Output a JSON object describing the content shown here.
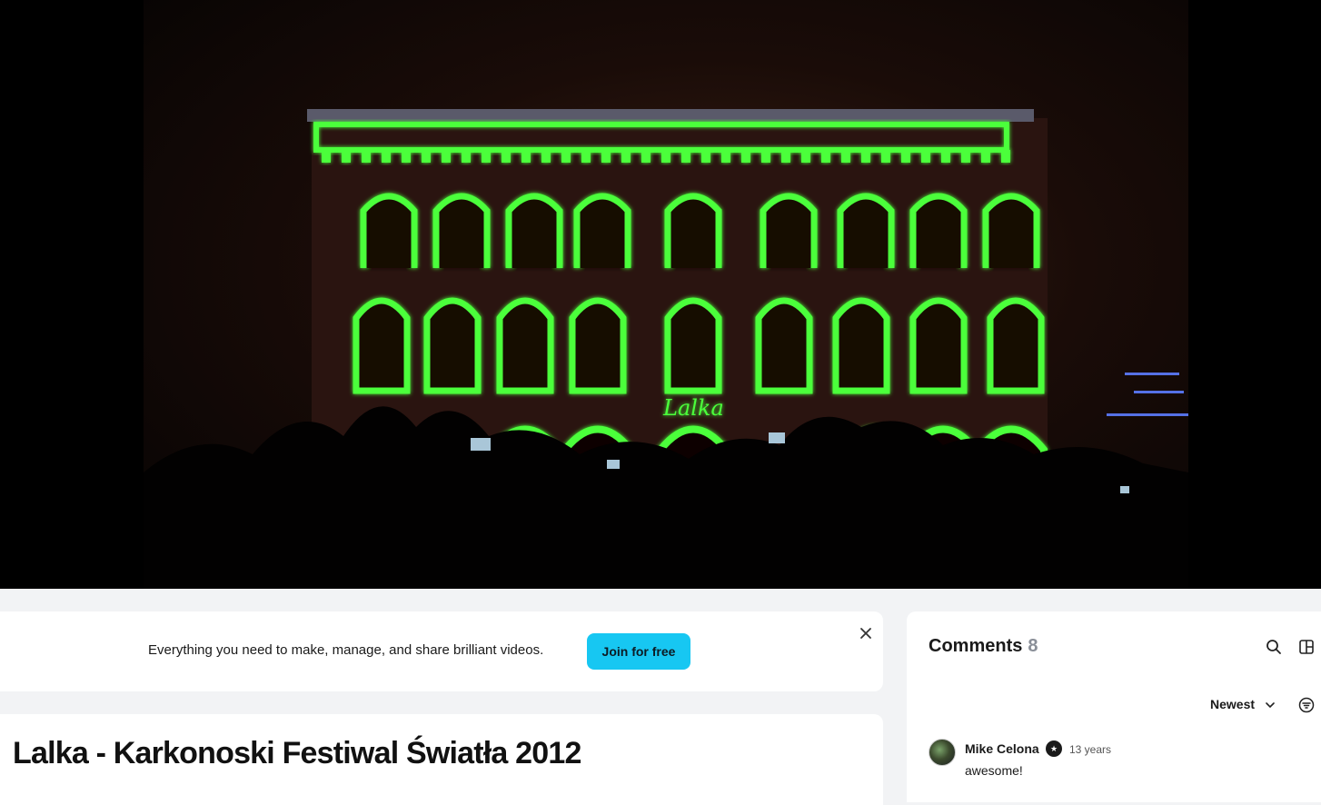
{
  "video": {
    "sign_text": "Lalka"
  },
  "banner": {
    "text": "Everything you need to make, manage, and share brilliant videos.",
    "cta_label": "Join for free",
    "close_icon": "close-icon"
  },
  "video_info": {
    "title": "Lalka - Karkonoski Festiwal Światła 2012"
  },
  "comments": {
    "heading": "Comments",
    "count": "8",
    "search_icon": "search-icon",
    "panel_icon": "panel-toggle-icon",
    "sort_label": "Newest",
    "filter_icon": "filter-icon",
    "items": [
      {
        "author": "Mike Celona",
        "badge_icon": "member-badge-icon",
        "time": "13 years",
        "body": "awesome!"
      }
    ]
  },
  "colors": {
    "accent": "#17c7f2",
    "projection_green": "#4cff3a",
    "count_gray": "#8a8f98"
  }
}
